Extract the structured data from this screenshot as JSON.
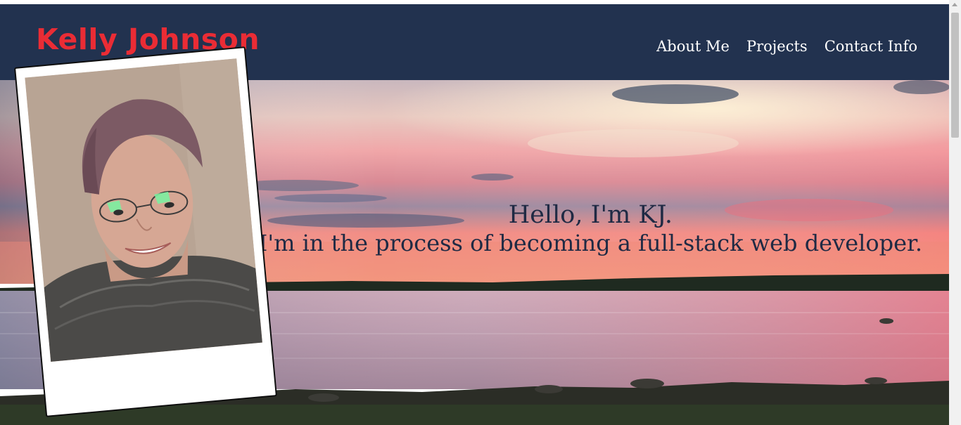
{
  "header": {
    "brand_name": "Kelly Johnson",
    "nav": [
      {
        "label": "About Me"
      },
      {
        "label": "Projects"
      },
      {
        "label": "Contact Info"
      }
    ]
  },
  "hero": {
    "greeting": "Hello, I'm KJ.",
    "tagline": "I'm in the process of becoming a full-stack web developer."
  },
  "colors": {
    "navbar_bg": "#22324f",
    "brand": "#ea2c35",
    "nav_text": "#ffffff",
    "hero_text": "#1f2a44"
  },
  "icons": {
    "scroll_up": "scroll-up-arrow-icon"
  }
}
